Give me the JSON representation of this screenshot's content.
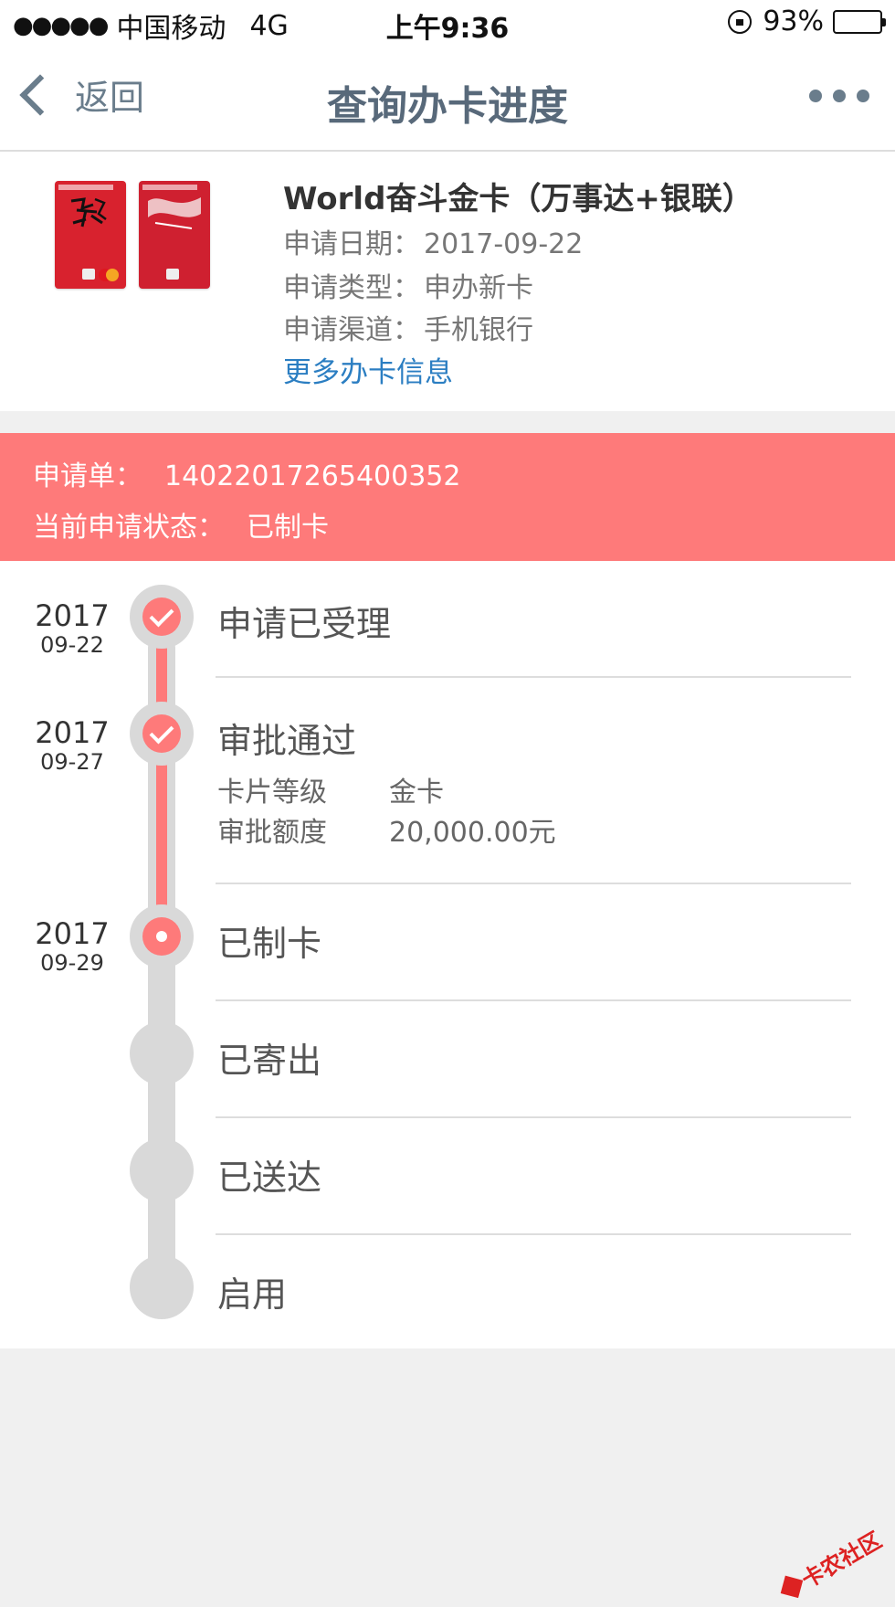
{
  "status_bar": {
    "signal_dots": "●●●●●",
    "carrier": "中国移动",
    "network": "4G",
    "time": "上午9:36",
    "battery_percent": "93%",
    "battery_level": 0.93
  },
  "nav": {
    "back_label": "返回",
    "title": "查询办卡进度"
  },
  "card": {
    "name": "World奋斗金卡（万事达+银联）",
    "fields": [
      {
        "label": "申请日期：",
        "value": "2017-09-22"
      },
      {
        "label": "申请类型：",
        "value": "申办新卡"
      },
      {
        "label": "申请渠道：",
        "value": "手机银行"
      }
    ],
    "more_info_link": "更多办卡信息"
  },
  "application": {
    "order_label": "申请单：",
    "order_number": "14022017265400352",
    "status_label": "当前申请状态：",
    "status_value": "已制卡"
  },
  "timeline": {
    "steps": [
      {
        "year": "2017",
        "date": "09-22",
        "title": "申请已受理",
        "state": "done"
      },
      {
        "year": "2017",
        "date": "09-27",
        "title": "审批通过",
        "state": "done",
        "details": [
          {
            "label": "卡片等级",
            "value": "金卡"
          },
          {
            "label": "审批额度",
            "value": "20,000.00元"
          }
        ]
      },
      {
        "year": "2017",
        "date": "09-29",
        "title": "已制卡",
        "state": "current"
      },
      {
        "year": "",
        "date": "",
        "title": "已寄出",
        "state": "pending"
      },
      {
        "year": "",
        "date": "",
        "title": "已送达",
        "state": "pending"
      },
      {
        "year": "",
        "date": "",
        "title": "启用",
        "state": "pending"
      }
    ]
  },
  "watermark": {
    "text": "卡农社区"
  },
  "colors": {
    "accent_red": "#fe7a7a",
    "link_blue": "#2b7ec2",
    "nav_gray": "#6a7d8c",
    "pending_gray": "#d9d9d9"
  },
  "icons": [
    "lock-rotation-icon",
    "battery-icon",
    "chevron-left-icon",
    "more-dots-icon",
    "check-icon"
  ]
}
